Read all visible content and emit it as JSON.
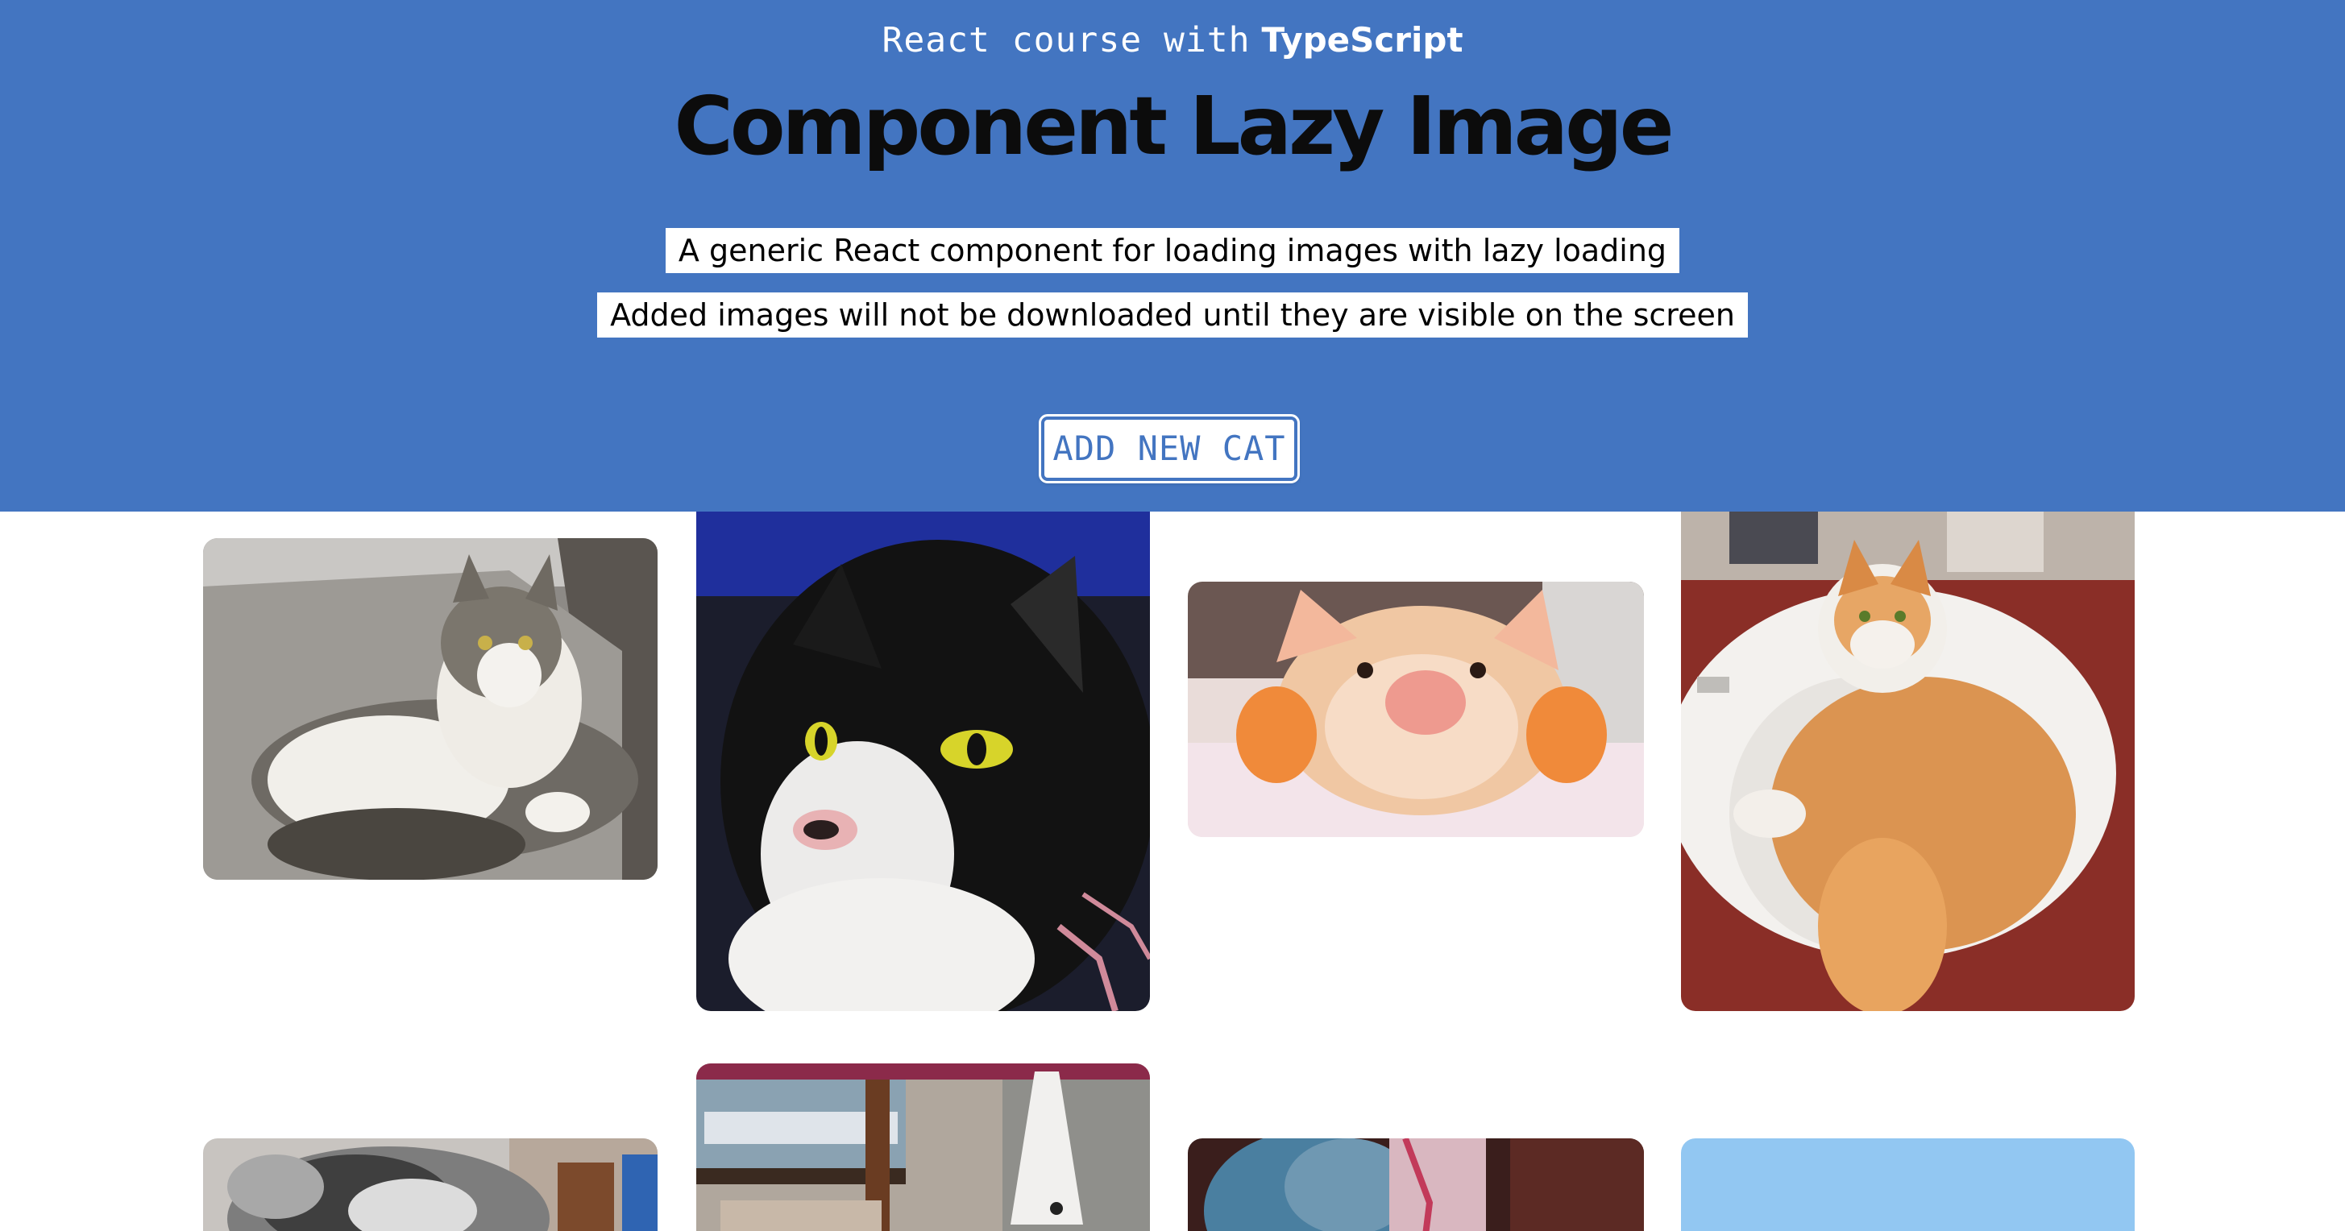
{
  "header": {
    "subtitle_prefix": "React course with",
    "subtitle_brand": "TypeScript",
    "title": "Component Lazy Image",
    "descriptions": [
      "A generic React component for loading images with lazy loading",
      "Added images will not be downloaded until they are visible on the screen"
    ],
    "add_button_label": "ADD NEW CAT"
  },
  "colors": {
    "header_bg": "#4375c1",
    "accent": "#4375c1",
    "placeholder_blue": "#92c7f2"
  },
  "gallery": {
    "images": [
      {
        "name": "cat-image-tabby-white-on-chair",
        "loaded": true
      },
      {
        "name": "cat-image-black-white-closeup",
        "loaded": true
      },
      {
        "name": "cat-image-orange-kitten-closeup",
        "loaded": true
      },
      {
        "name": "cat-image-ginger-in-sink",
        "loaded": true
      },
      {
        "name": "cat-image-grey-fluffy",
        "loaded": true
      },
      {
        "name": "cat-image-by-window-chair",
        "loaded": true
      },
      {
        "name": "cat-image-blue-blanket",
        "loaded": true
      },
      {
        "name": "cat-image-placeholder",
        "loaded": false
      }
    ]
  }
}
